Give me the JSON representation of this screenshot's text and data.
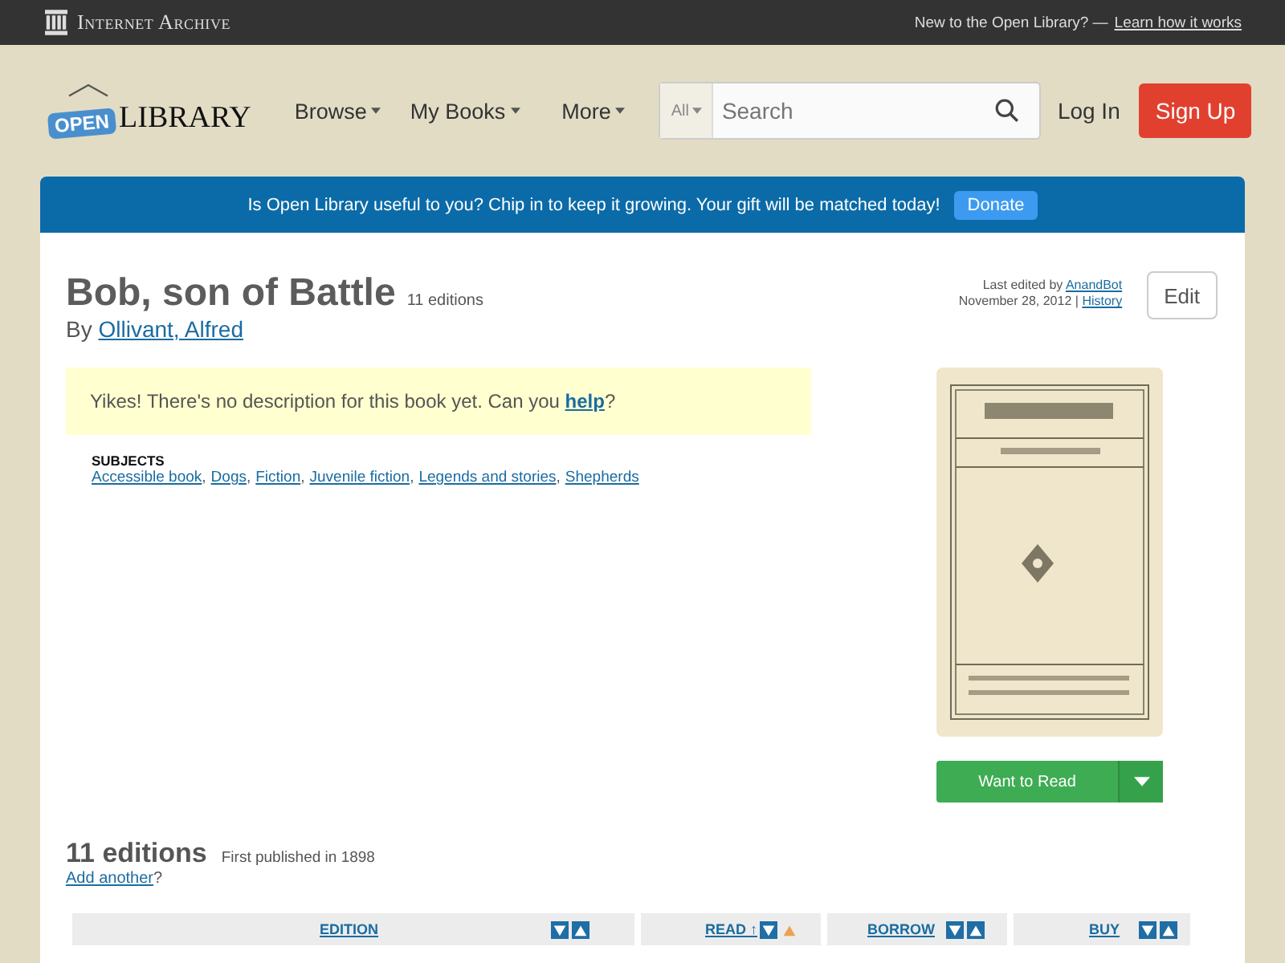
{
  "topbar": {
    "brand": "Internet Archive",
    "prompt": "New to the Open Library? —",
    "link": "Learn how it works"
  },
  "header": {
    "logo_badge": "OPEN",
    "logo_word": "LIBRARY",
    "nav": [
      "Browse",
      "My Books",
      "More"
    ],
    "search": {
      "scope": "All",
      "placeholder": "Search"
    },
    "login": "Log In",
    "signup": "Sign Up"
  },
  "banner": {
    "message": "Is Open Library useful to you? Chip in to keep it growing. Your gift will be matched today!",
    "button": "Donate"
  },
  "book": {
    "title": "Bob, son of Battle",
    "editions_count": "11 editions",
    "by": "By",
    "author": "Ollivant, Alfred",
    "edited_prefix": "Last edited by",
    "editor": "AnandBot",
    "edited_date": "November 28, 2012 |",
    "history": "History",
    "edit": "Edit",
    "description": {
      "before": "Yikes! There's no description for this book yet. Can you",
      "link": "help",
      "after": "?"
    },
    "subjects_label": "SUBJECTS",
    "subject_separator": ",",
    "subjects": [
      "Accessible book",
      "Dogs",
      "Fiction",
      "Juvenile fiction",
      "Legends and stories",
      "Shepherds"
    ],
    "want_to_read": "Want to Read"
  },
  "editions": {
    "heading": "11 editions",
    "first_published": "First published in 1898",
    "add_link": "Add another",
    "add_after": "?",
    "columns": [
      {
        "label": "EDITION",
        "sorted": false
      },
      {
        "label": "READ ↑",
        "sorted": true
      },
      {
        "label": "BORROW",
        "sorted": false
      },
      {
        "label": "BUY",
        "sorted": false
      }
    ]
  }
}
